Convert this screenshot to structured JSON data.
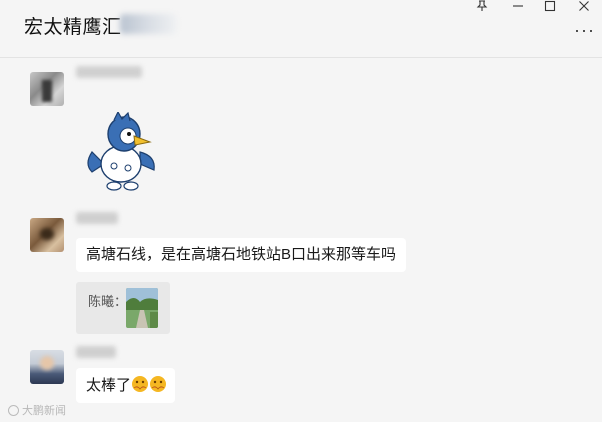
{
  "header": {
    "title": "宏太精鹰汇",
    "pin_icon": "pin-icon",
    "minimize_icon": "minimize-icon",
    "maximize_icon": "maximize-icon",
    "close_icon": "close-icon",
    "more_icon": "more-icon"
  },
  "messages": [
    {
      "type": "sticker",
      "sticker": "blue-bird-sticker"
    },
    {
      "type": "text",
      "text": "高塘石线，是在高塘石地铁站B口出来那等车吗",
      "quote_author": "陈曦："
    },
    {
      "type": "text",
      "text": "太棒了",
      "emojis": [
        "heart-hands-emoji",
        "heart-hands-emoji"
      ]
    }
  ],
  "watermark": {
    "text": "大鹏新闻"
  },
  "colors": {
    "background": "#f5f5f5",
    "bubble": "#ffffff",
    "quote": "#e8e8e8",
    "sticker_blue": "#3a6fb5",
    "emoji_yellow": "#f5b722"
  }
}
